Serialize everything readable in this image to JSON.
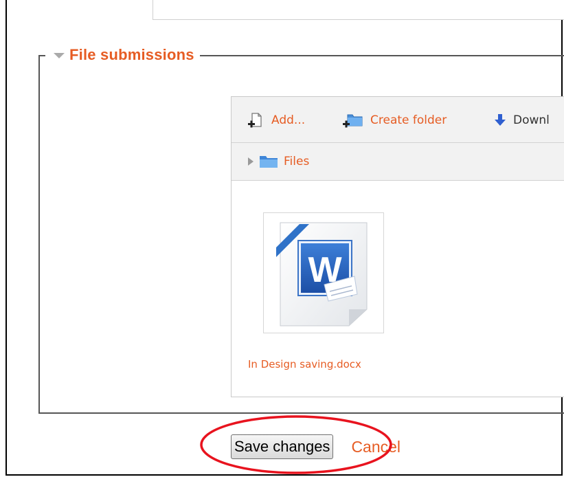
{
  "fieldset": {
    "title": "File submissions"
  },
  "filemanager": {
    "toolbar": {
      "add_label": "Add...",
      "create_folder_label": "Create folder",
      "download_label": "Downl"
    },
    "path": {
      "folder_label": "Files"
    },
    "files": [
      {
        "name": "In Design saving.docx",
        "icon": "word-document-icon"
      }
    ]
  },
  "form": {
    "save_label": "Save changes",
    "cancel_label": "Cancel"
  },
  "colors": {
    "accent": "#e65c23",
    "highlight": "#e8131e",
    "folder": "#4a8fd8"
  }
}
